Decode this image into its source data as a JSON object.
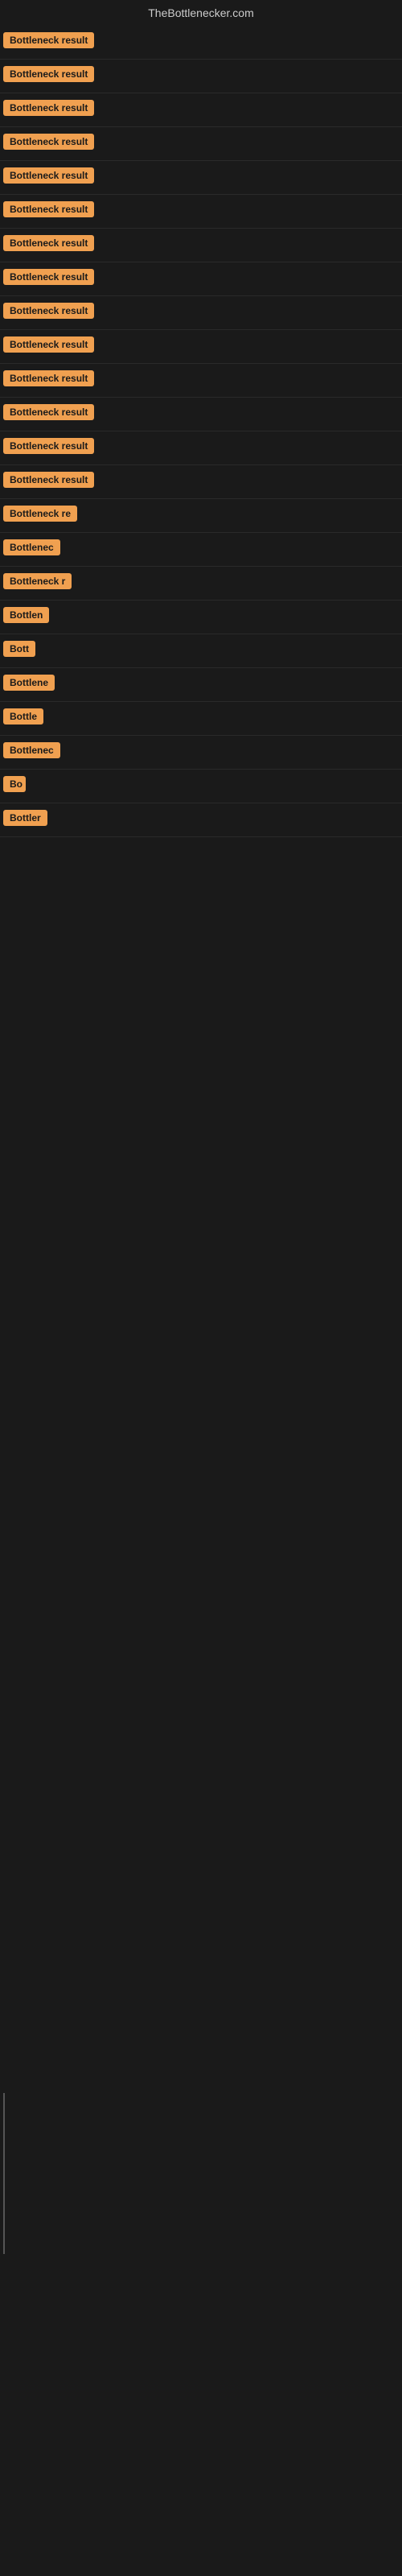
{
  "header": {
    "title": "TheBottlenecker.com"
  },
  "results": [
    {
      "id": 1,
      "label": "Bottleneck result",
      "width": 120
    },
    {
      "id": 2,
      "label": "Bottleneck result",
      "width": 120
    },
    {
      "id": 3,
      "label": "Bottleneck result",
      "width": 120
    },
    {
      "id": 4,
      "label": "Bottleneck result",
      "width": 120
    },
    {
      "id": 5,
      "label": "Bottleneck result",
      "width": 120
    },
    {
      "id": 6,
      "label": "Bottleneck result",
      "width": 120
    },
    {
      "id": 7,
      "label": "Bottleneck result",
      "width": 120
    },
    {
      "id": 8,
      "label": "Bottleneck result",
      "width": 120
    },
    {
      "id": 9,
      "label": "Bottleneck result",
      "width": 120
    },
    {
      "id": 10,
      "label": "Bottleneck result",
      "width": 120
    },
    {
      "id": 11,
      "label": "Bottleneck result",
      "width": 120
    },
    {
      "id": 12,
      "label": "Bottleneck result",
      "width": 120
    },
    {
      "id": 13,
      "label": "Bottleneck result",
      "width": 120
    },
    {
      "id": 14,
      "label": "Bottleneck result",
      "width": 120
    },
    {
      "id": 15,
      "label": "Bottleneck re",
      "width": 100
    },
    {
      "id": 16,
      "label": "Bottlenec",
      "width": 80
    },
    {
      "id": 17,
      "label": "Bottleneck r",
      "width": 90
    },
    {
      "id": 18,
      "label": "Bottlen",
      "width": 70
    },
    {
      "id": 19,
      "label": "Bott",
      "width": 45
    },
    {
      "id": 20,
      "label": "Bottlene",
      "width": 72
    },
    {
      "id": 21,
      "label": "Bottle",
      "width": 58
    },
    {
      "id": 22,
      "label": "Bottlenec",
      "width": 80
    },
    {
      "id": 23,
      "label": "Bo",
      "width": 28
    },
    {
      "id": 24,
      "label": "Bottler",
      "width": 60
    }
  ]
}
